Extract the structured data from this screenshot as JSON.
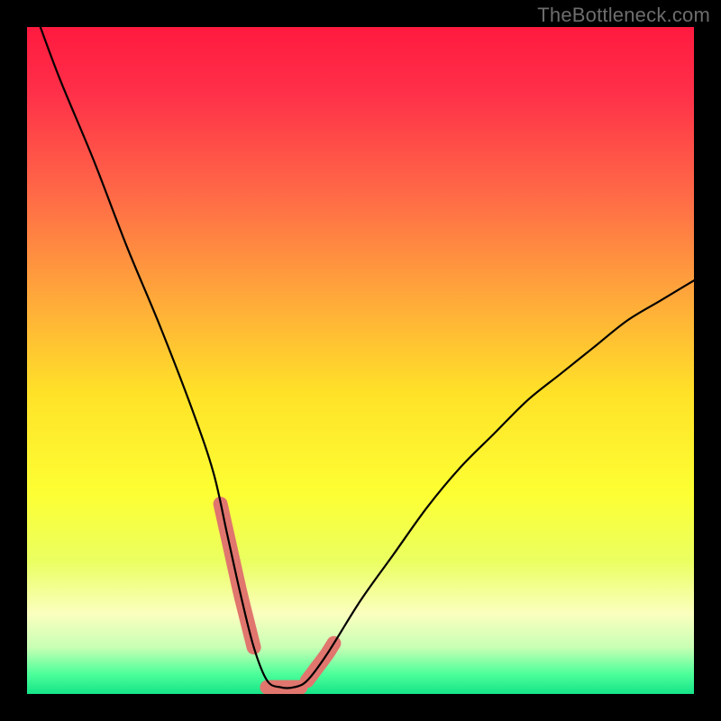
{
  "watermark": "TheBottleneck.com",
  "chart_data": {
    "type": "line",
    "title": "",
    "xlabel": "",
    "ylabel": "",
    "xlim": [
      0,
      100
    ],
    "ylim": [
      0,
      100
    ],
    "series": [
      {
        "name": "bottleneck-curve",
        "x": [
          2,
          5,
          10,
          15,
          20,
          25,
          28,
          30,
          32,
          34,
          36,
          38,
          40,
          42,
          45,
          50,
          55,
          60,
          65,
          70,
          75,
          80,
          85,
          90,
          95,
          100
        ],
        "values": [
          100,
          92,
          80,
          67,
          55,
          42,
          33,
          24,
          15,
          7,
          2,
          1,
          1,
          2,
          6,
          14,
          21,
          28,
          34,
          39,
          44,
          48,
          52,
          56,
          59,
          62
        ]
      }
    ],
    "highlight_ranges": [
      {
        "name": "left-marker",
        "x_start": 29,
        "x_end": 34
      },
      {
        "name": "right-marker",
        "x_start": 42,
        "x_end": 46
      }
    ],
    "gradient_stops": [
      {
        "offset": 0.0,
        "color": "#ff1a3f"
      },
      {
        "offset": 0.1,
        "color": "#ff3049"
      },
      {
        "offset": 0.25,
        "color": "#ff6947"
      },
      {
        "offset": 0.4,
        "color": "#ffa63b"
      },
      {
        "offset": 0.55,
        "color": "#ffe228"
      },
      {
        "offset": 0.7,
        "color": "#fdff33"
      },
      {
        "offset": 0.8,
        "color": "#eaff60"
      },
      {
        "offset": 0.88,
        "color": "#fbffbf"
      },
      {
        "offset": 0.93,
        "color": "#c8ffb4"
      },
      {
        "offset": 0.97,
        "color": "#4dff9a"
      },
      {
        "offset": 1.0,
        "color": "#15e487"
      }
    ],
    "flat_segment": {
      "x_start": 36,
      "x_end": 41,
      "y": 1
    }
  }
}
